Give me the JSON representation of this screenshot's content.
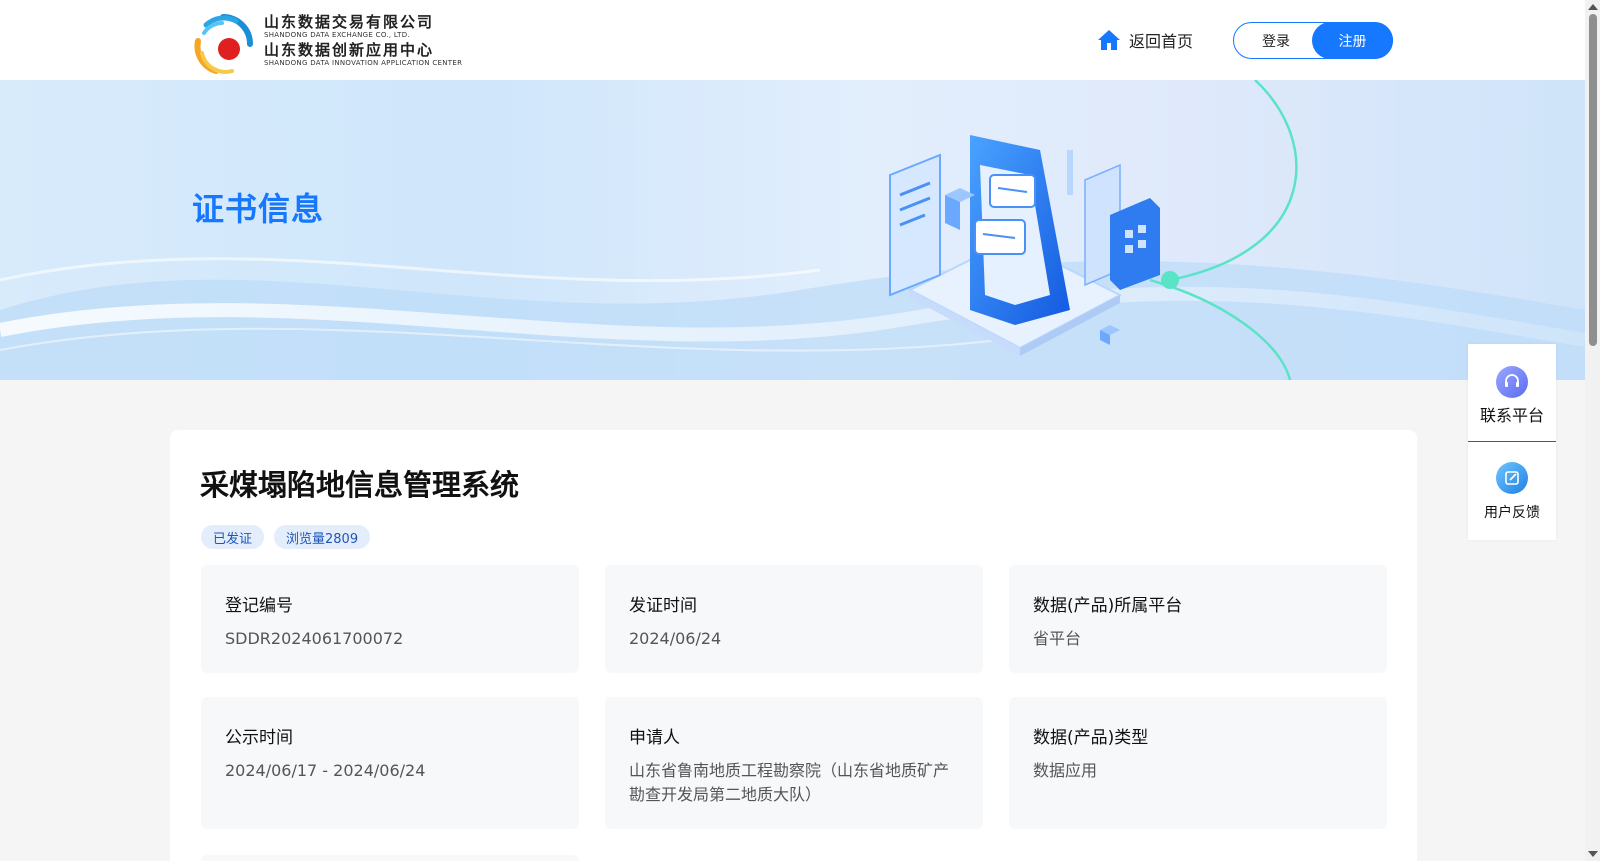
{
  "header": {
    "logo": {
      "line1_cn": "山东数据交易有限公司",
      "line1_en": "SHANDONG DATA EXCHANGE CO., LTD.",
      "line2_cn": "山东数据创新应用中心",
      "line2_en": "SHANDONG DATA INNOVATION APPLICATION CENTER"
    },
    "home_label": "返回首页",
    "login_label": "登录",
    "register_label": "注册",
    "accent_color": "#1677ff"
  },
  "banner": {
    "title": "证书信息"
  },
  "product": {
    "title": "采煤塌陷地信息管理系统",
    "tags": [
      {
        "label": "已发证"
      },
      {
        "label": "浏览量2809"
      }
    ],
    "fields": [
      {
        "label": "登记编号",
        "value": "SDDR2024061700072"
      },
      {
        "label": "发证时间",
        "value": "2024/06/24"
      },
      {
        "label": "数据(产品)所属平台",
        "value": "省平台"
      },
      {
        "label": "公示时间",
        "value": "2024/06/17 - 2024/06/24"
      },
      {
        "label": "申请人",
        "value": "山东省鲁南地质工程勘察院（山东省地质矿产勘查开发局第二地质大队）"
      },
      {
        "label": "数据(产品)类型",
        "value": "数据应用"
      }
    ]
  },
  "side_panel": {
    "contact_label": "联系平台",
    "feedback_label": "用户反馈"
  }
}
